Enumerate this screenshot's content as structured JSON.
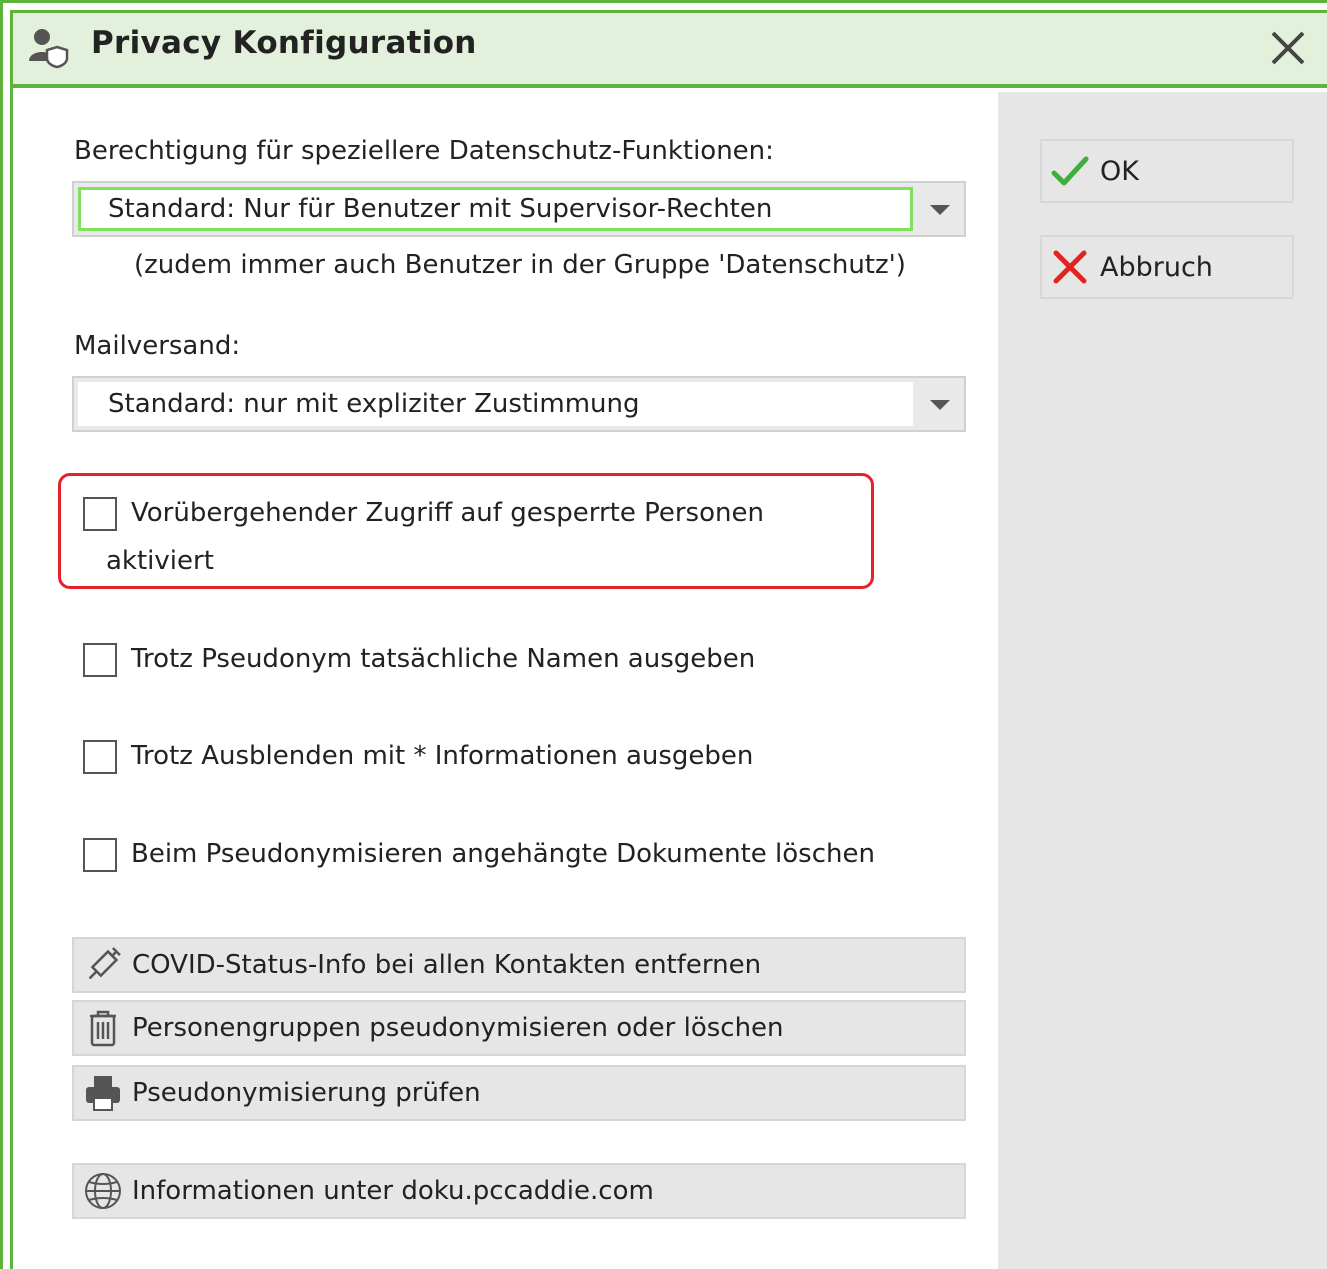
{
  "window": {
    "title": "Privacy Konfiguration",
    "title_icon": "user-shield-icon",
    "close_icon": "close-icon"
  },
  "side": {
    "ok_label": "OK",
    "cancel_label": "Abbruch"
  },
  "permission": {
    "label": "Berechtigung für speziellere Datenschutz-Funktionen:",
    "value": "Standard: Nur für Benutzer mit Supervisor-Rechten",
    "note": "(zudem immer auch Benutzer in der Gruppe 'Datenschutz')"
  },
  "mail": {
    "label": "Mailversand:",
    "value": "Standard: nur mit expliziter Zustimmung"
  },
  "checkboxes": [
    {
      "label_line1": "Vorübergehender Zugriff auf gesperrte Personen",
      "label_line2": "aktiviert",
      "checked": false
    },
    {
      "label_line1": "Trotz Pseudonym tatsächliche Namen ausgeben",
      "checked": false
    },
    {
      "label_line1": "Trotz Ausblenden mit * Informationen ausgeben",
      "checked": false
    },
    {
      "label_line1": "Beim Pseudonymisieren angehängte Dokumente löschen",
      "checked": false
    }
  ],
  "actions": [
    {
      "label": "COVID-Status-Info bei allen Kontakten entfernen",
      "icon": "syringe-icon"
    },
    {
      "label": "Personengruppen pseudonymisieren oder löschen",
      "icon": "trash-icon"
    },
    {
      "label": "Pseudonymisierung prüfen",
      "icon": "printer-icon"
    },
    {
      "label": "Informationen unter doku.pccaddie.com",
      "icon": "globe-icon"
    }
  ],
  "colors": {
    "accent_green": "#5db33b",
    "title_bg": "#e3f0dc",
    "highlight_red": "#e8202a",
    "focus_green": "#7de35a"
  }
}
